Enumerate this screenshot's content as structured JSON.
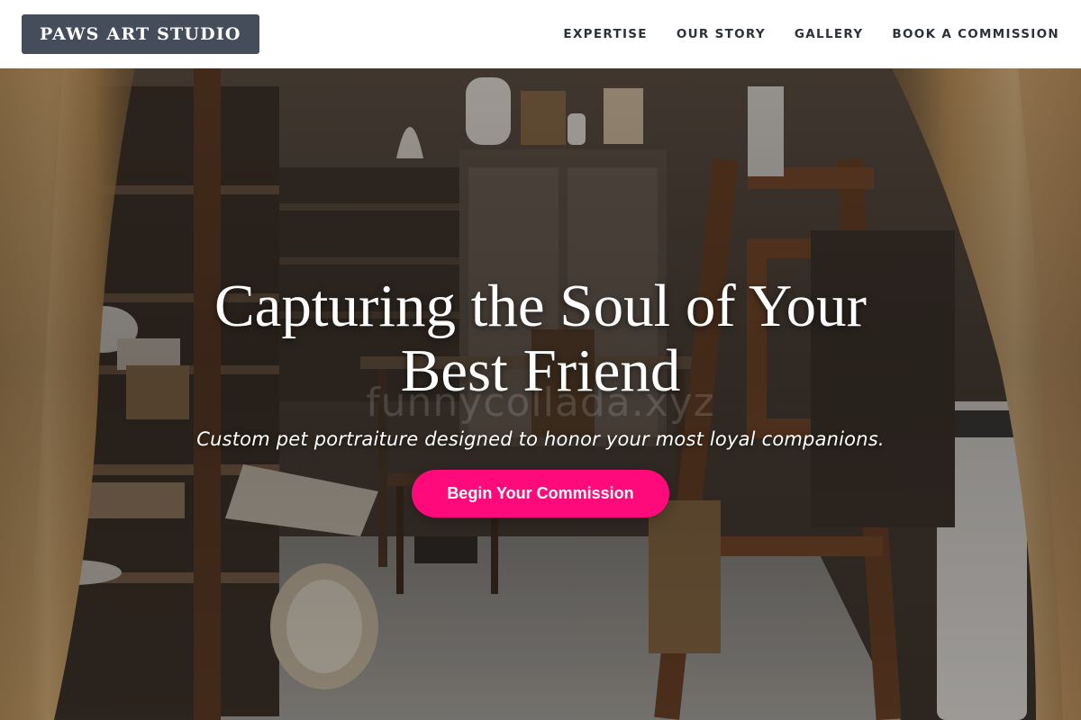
{
  "header": {
    "brand": "PAWS ART STUDIO",
    "nav": [
      {
        "label": "EXPERTISE"
      },
      {
        "label": "OUR STORY"
      },
      {
        "label": "GALLERY"
      },
      {
        "label": "BOOK A COMMISSION"
      }
    ]
  },
  "hero": {
    "title": "Capturing the Soul of Your Best Friend",
    "subtitle": "Custom pet portraiture designed to honor your most loyal companions.",
    "cta_label": "Begin Your Commission",
    "watermark": "funnycollada.xyz",
    "background_image": "artist studio interior with easels, shelves and curtains"
  },
  "colors": {
    "brand_bg": "#454d5b",
    "nav_text": "#2c313a",
    "cta_bg": "#ff0a7a",
    "cta_text": "#ffffff"
  }
}
